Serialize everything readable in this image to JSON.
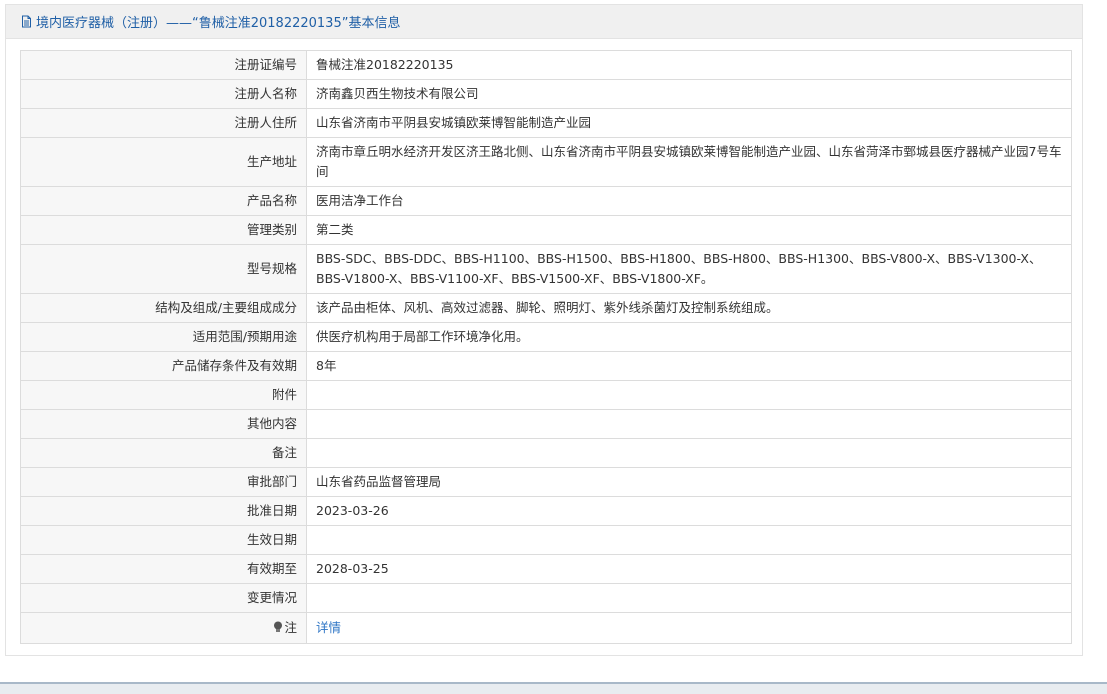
{
  "header": {
    "title": "境内医疗器械（注册）——“鲁械注准20182220135”基本信息"
  },
  "rows": [
    {
      "label": "注册证编号",
      "value": "鲁械注准20182220135"
    },
    {
      "label": "注册人名称",
      "value": "济南鑫贝西生物技术有限公司"
    },
    {
      "label": "注册人住所",
      "value": "山东省济南市平阴县安城镇欧莱博智能制造产业园"
    },
    {
      "label": "生产地址",
      "value": "济南市章丘明水经济开发区济王路北侧、山东省济南市平阴县安城镇欧莱博智能制造产业园、山东省菏泽市鄄城县医疗器械产业园7号车间"
    },
    {
      "label": "产品名称",
      "value": "医用洁净工作台"
    },
    {
      "label": "管理类别",
      "value": "第二类"
    },
    {
      "label": "型号规格",
      "value": "BBS-SDC、BBS-DDC、BBS-H1100、BBS-H1500、BBS-H1800、BBS-H800、BBS-H1300、BBS-V800-X、BBS-V1300-X、BBS-V1800-X、BBS-V1100-XF、BBS-V1500-XF、BBS-V1800-XF。"
    },
    {
      "label": "结构及组成/主要组成成分",
      "value": "该产品由柜体、风机、高效过滤器、脚轮、照明灯、紫外线杀菌灯及控制系统组成。"
    },
    {
      "label": "适用范围/预期用途",
      "value": "供医疗机构用于局部工作环境净化用。"
    },
    {
      "label": "产品储存条件及有效期",
      "value": "8年"
    },
    {
      "label": "附件",
      "value": ""
    },
    {
      "label": "其他内容",
      "value": ""
    },
    {
      "label": "备注",
      "value": ""
    },
    {
      "label": "审批部门",
      "value": "山东省药品监督管理局"
    },
    {
      "label": "批准日期",
      "value": "2023-03-26"
    },
    {
      "label": "生效日期",
      "value": ""
    },
    {
      "label": "有效期至",
      "value": "2028-03-25"
    },
    {
      "label": "变更情况",
      "value": ""
    }
  ],
  "note_row": {
    "label": "注",
    "link": "详情",
    "icon": "bulb-icon"
  },
  "colors": {
    "header_text": "#1f5fa6",
    "link": "#2e75c5",
    "label_bg": "#f7f7f7",
    "border": "#dcdcdc"
  }
}
